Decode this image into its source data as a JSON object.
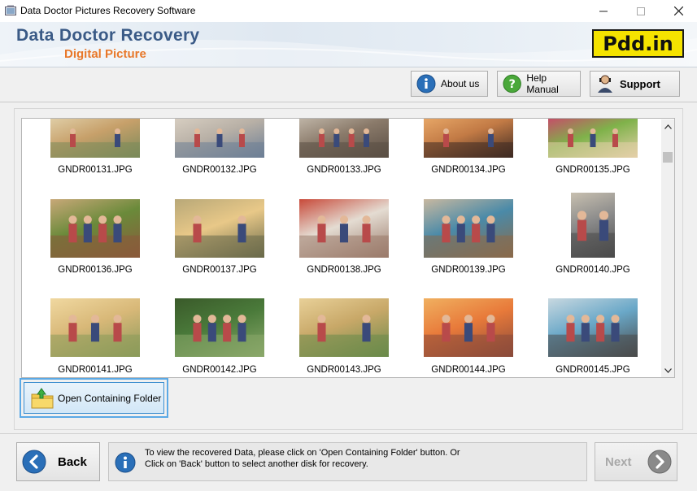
{
  "window": {
    "title": "Data Doctor Pictures Recovery Software",
    "minimize_glyph": "—",
    "maximize_glyph": "☐",
    "close_glyph": "✕"
  },
  "banner": {
    "brand_line1": "Data Doctor Recovery",
    "brand_line2": "Digital Picture",
    "logo_text": "Pdd.in",
    "colors": {
      "brand_blue": "#3a5a86",
      "brand_orange": "#e8782a",
      "logo_yellow": "#f5e300"
    }
  },
  "toolbar": {
    "about_label": "About us",
    "help_label": "Help Manual",
    "support_label": "Support",
    "about_icon": "info-icon",
    "help_icon": "help-icon",
    "support_icon": "support-person-icon"
  },
  "gallery": {
    "items": [
      {
        "label": "GNDR00131.JPG",
        "palette": [
          "#c7a06a",
          "#7a8a5a",
          "#e0cfa8"
        ]
      },
      {
        "label": "GNDR00132.JPG",
        "palette": [
          "#b8b0a6",
          "#6d7f96",
          "#d8cfc2"
        ]
      },
      {
        "label": "GNDR00133.JPG",
        "palette": [
          "#8a7a6a",
          "#5a4e44",
          "#c0b6a8"
        ]
      },
      {
        "label": "GNDR00134.JPG",
        "palette": [
          "#c27a45",
          "#3e2a22",
          "#e8a868"
        ]
      },
      {
        "label": "GNDR00135.JPG",
        "palette": [
          "#7fb24a",
          "#e4cfa8",
          "#c84a6a"
        ]
      },
      {
        "label": "GNDR00136.JPG",
        "palette": [
          "#6a8a3a",
          "#8a5a3a",
          "#c8a878"
        ]
      },
      {
        "label": "GNDR00137.JPG",
        "palette": [
          "#e8c888",
          "#6a6a4a",
          "#b8a878"
        ]
      },
      {
        "label": "GNDR00138.JPG",
        "palette": [
          "#e4dcd2",
          "#9a7a6a",
          "#c84a3a"
        ]
      },
      {
        "label": "GNDR00139.JPG",
        "palette": [
          "#4a8aa8",
          "#8a6a4a",
          "#c8b8a0"
        ]
      },
      {
        "label": "GNDR00140.JPG",
        "palette": [
          "#8a8a8a",
          "#4a4a4a",
          "#c8c0b0"
        ]
      },
      {
        "label": "GNDR00141.JPG",
        "palette": [
          "#d8b878",
          "#8a9a5a",
          "#f0d8a0"
        ]
      },
      {
        "label": "GNDR00142.JPG",
        "palette": [
          "#4a7a3a",
          "#8aa86a",
          "#3a5a2a"
        ]
      },
      {
        "label": "GNDR00143.JPG",
        "palette": [
          "#c8a868",
          "#6a8a4a",
          "#e8d098"
        ]
      },
      {
        "label": "GNDR00144.JPG",
        "palette": [
          "#e87a3a",
          "#8a4a3a",
          "#f0b060"
        ]
      },
      {
        "label": "GNDR00145.JPG",
        "palette": [
          "#6aa8c8",
          "#4a4a4a",
          "#c8d8e0"
        ]
      }
    ]
  },
  "open_folder": {
    "label": "Open Containing Folder",
    "icon": "folder-up-arrow-icon"
  },
  "bottom": {
    "back_label": "Back",
    "next_label": "Next",
    "info_line1": "To view the recovered Data, please click on 'Open Containing Folder' button. Or",
    "info_line2": "Click on 'Back' button to select another disk for recovery."
  }
}
